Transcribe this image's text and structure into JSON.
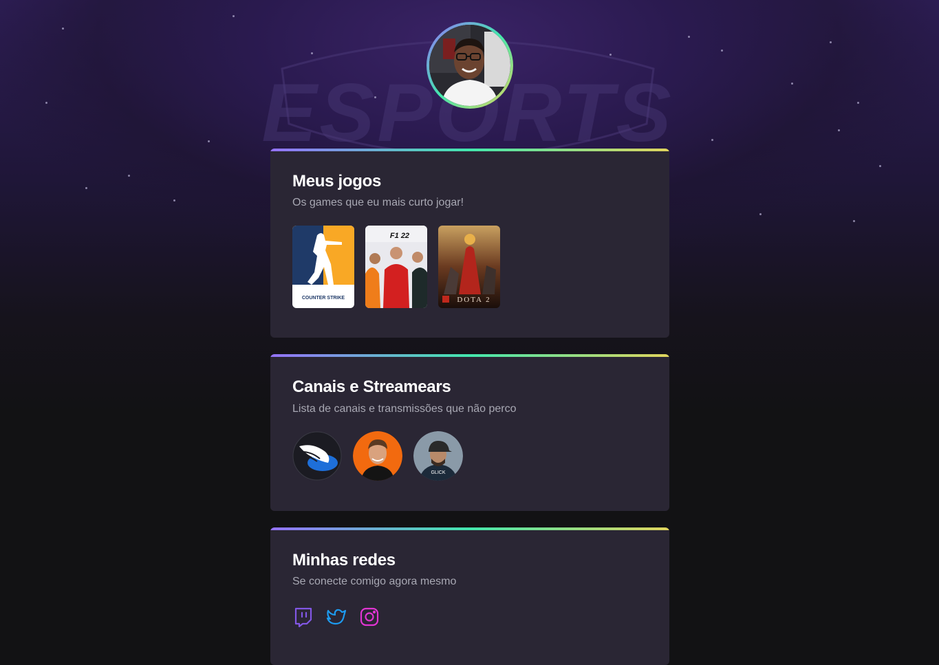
{
  "profile": {
    "avatar_alt": "Foto de perfil"
  },
  "background": {
    "logo_text": "ESPORTS"
  },
  "games_section": {
    "title": "Meus jogos",
    "subtitle": "Os games que eu mais curto jogar!",
    "games": [
      {
        "name": "Counter Strike",
        "cover_text": "COUNTER STRIKE"
      },
      {
        "name": "F1 22",
        "cover_text": "F1 22"
      },
      {
        "name": "Dota 2",
        "cover_text": "DOTA 2"
      }
    ]
  },
  "streamers_section": {
    "title": "Canais e Streamears",
    "subtitle": "Lista de canais e transmissões que não perco",
    "channels": [
      {
        "name": "channel-wing"
      },
      {
        "name": "channel-orange"
      },
      {
        "name": "channel-cap"
      }
    ],
    "cap_text": "GLICK"
  },
  "social_section": {
    "title": "Minhas redes",
    "subtitle": "Se conecte comigo agora mesmo",
    "links": [
      {
        "icon": "twitch-icon",
        "color": "#8257e5"
      },
      {
        "icon": "twitter-icon",
        "color": "#1d9bf0"
      },
      {
        "icon": "instagram-icon",
        "color": "#e135d3"
      }
    ]
  }
}
